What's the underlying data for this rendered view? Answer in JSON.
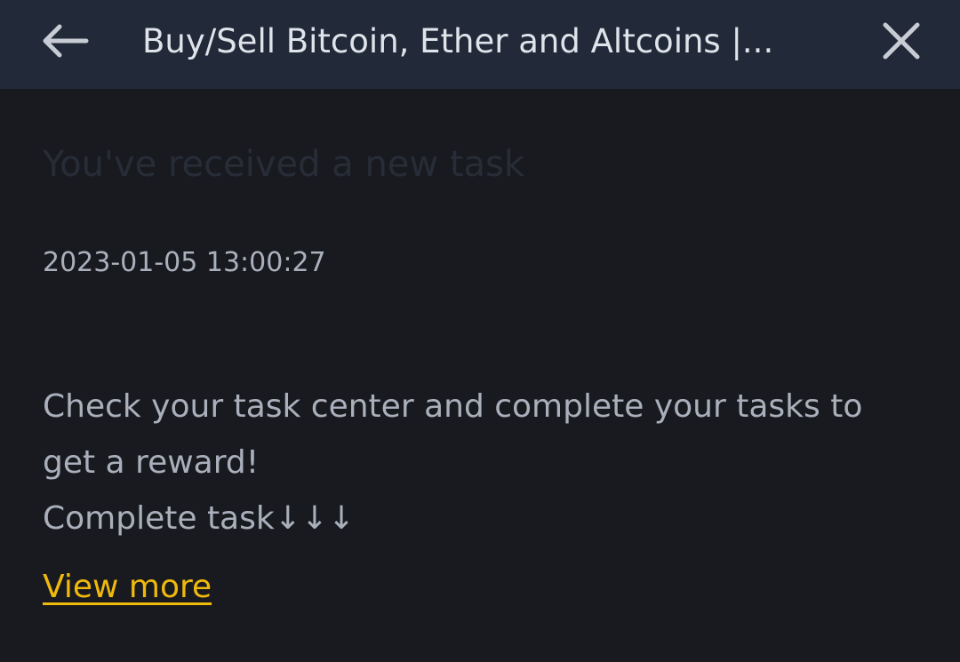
{
  "header": {
    "title": "Buy/Sell Bitcoin, Ether and Altcoins |...",
    "back_icon": "arrow-left-icon",
    "close_icon": "close-icon"
  },
  "message": {
    "title": "You've received a new task",
    "timestamp": "2023-01-05 13:00:27",
    "body_line1": "Check your task center and complete your tasks to get a reward!",
    "body_line2": "Complete task↓↓↓",
    "link_label": "View more"
  },
  "colors": {
    "background": "#181a20",
    "header_background": "#222938",
    "link": "#f0b90b",
    "text": "#aab0bb"
  }
}
